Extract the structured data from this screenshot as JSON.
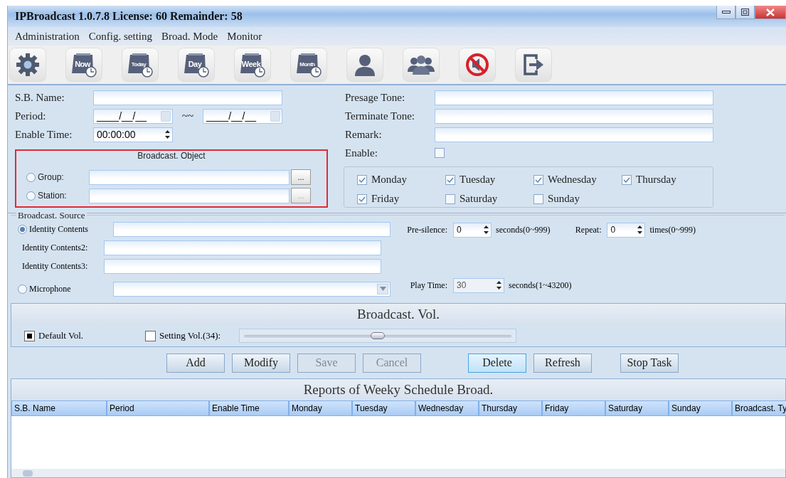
{
  "window": {
    "title": "IPBroadcast 1.0.7.8 License: 60 Remainder: 58"
  },
  "menu": [
    "Administration",
    "Config. setting",
    "Broad. Mode",
    "Monitor"
  ],
  "toolbar": [
    {
      "kind": "gear"
    },
    {
      "kind": "calendar",
      "label": "Now"
    },
    {
      "kind": "calendar",
      "label": "Today"
    },
    {
      "kind": "calendar",
      "label": "Day"
    },
    {
      "kind": "calendar",
      "label": "Week"
    },
    {
      "kind": "calendar",
      "label": "Month"
    },
    {
      "kind": "person"
    },
    {
      "kind": "people"
    },
    {
      "kind": "mute"
    },
    {
      "kind": "exit"
    }
  ],
  "form": {
    "sb_name": {
      "label": "S.B. Name:"
    },
    "period": {
      "label": "Period:",
      "start_value": "____/__/__",
      "separator": "~~",
      "end_value": "____/__/__"
    },
    "enable_time": {
      "label": "Enable Time:",
      "value": "00:00:00"
    },
    "broadcast_object": {
      "title": "Broadcast. Object",
      "options": [
        {
          "label": "Group:",
          "selected": false,
          "browse": "...",
          "browse_disabled": false
        },
        {
          "label": "Station:",
          "selected": false,
          "browse": "...",
          "browse_disabled": true
        }
      ]
    },
    "presage_tone": {
      "label": "Presage Tone:"
    },
    "terminate_tone": {
      "label": "Terminate Tone:"
    },
    "remark": {
      "label": "Remark:"
    },
    "enable": {
      "label": "Enable:",
      "checked": false
    },
    "days": [
      {
        "label": "Monday",
        "checked": true
      },
      {
        "label": "Tuesday",
        "checked": true
      },
      {
        "label": "Wednesday",
        "checked": true
      },
      {
        "label": "Thursday",
        "checked": true
      },
      {
        "label": "Friday",
        "checked": true
      },
      {
        "label": "Saturday",
        "checked": false
      },
      {
        "label": "Sunday",
        "checked": false
      }
    ]
  },
  "source": {
    "title": "Broadcast. Source",
    "rows": [
      {
        "kind": "radio",
        "label": "Identity Contents",
        "selected": true
      },
      {
        "kind": "plain",
        "label": "Identity Contents2:"
      },
      {
        "kind": "plain",
        "label": "Identity Contents3:"
      },
      {
        "kind": "dropdown",
        "label": "Microphone",
        "selected": false
      }
    ],
    "pre_silence": {
      "label": "Pre-silence:",
      "value": "0",
      "unit": "seconds(0~999)"
    },
    "repeat": {
      "label": "Repeat:",
      "value": "0",
      "unit": "times(0~999)"
    },
    "play_time": {
      "label": "Play Time:",
      "value": "30",
      "unit": "seconds(1~43200)",
      "disabled": true
    }
  },
  "volume": {
    "title": "Broadcast. Vol.",
    "default": {
      "label": "Default Vol.",
      "checked": true
    },
    "setting": {
      "label": "Setting Vol.(34):",
      "checked": false
    },
    "level": 0.5
  },
  "buttons": [
    {
      "label": "Add",
      "disabled": false,
      "focused": false
    },
    {
      "label": "Modify",
      "disabled": false,
      "focused": false
    },
    {
      "label": "Save",
      "disabled": true,
      "focused": false
    },
    {
      "label": "Cancel",
      "disabled": true,
      "focused": false
    },
    {
      "label": "Delete",
      "disabled": false,
      "focused": true
    },
    {
      "label": "Refresh",
      "disabled": false,
      "focused": false
    },
    {
      "label": "Stop Task",
      "disabled": false,
      "focused": false
    }
  ],
  "table": {
    "title": "Reports of Weeky Schedule Broad.",
    "columns": [
      "S.B. Name",
      "Period",
      "Enable Time",
      "Monday",
      "Tuesday",
      "Wednesday",
      "Thursday",
      "Friday",
      "Saturday",
      "Sunday",
      "Broadcast. Ty"
    ]
  }
}
